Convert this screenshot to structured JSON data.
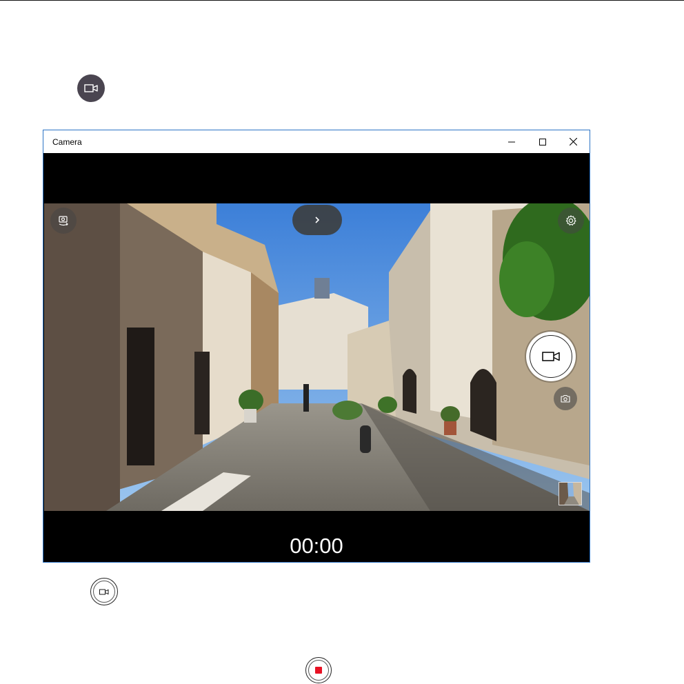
{
  "window": {
    "title": "Camera",
    "controls": [
      "minimize",
      "maximize",
      "close"
    ]
  },
  "camera": {
    "timer": "00:00",
    "buttons": {
      "photo_mode": "camera-switch-icon",
      "expand": "chevron-right-icon",
      "settings": "gear-icon",
      "record": "video-camera-icon",
      "photo": "photo-camera-icon",
      "gallery": "thumbnail-preview"
    }
  },
  "document_icons": {
    "dark_video_button": "video-camera-icon",
    "outline_video_button": "video-camera-icon",
    "stop_button": "stop-icon"
  },
  "colors": {
    "window_border": "#2b73c4",
    "stop_red": "#e81123",
    "overlay": "#464646"
  }
}
